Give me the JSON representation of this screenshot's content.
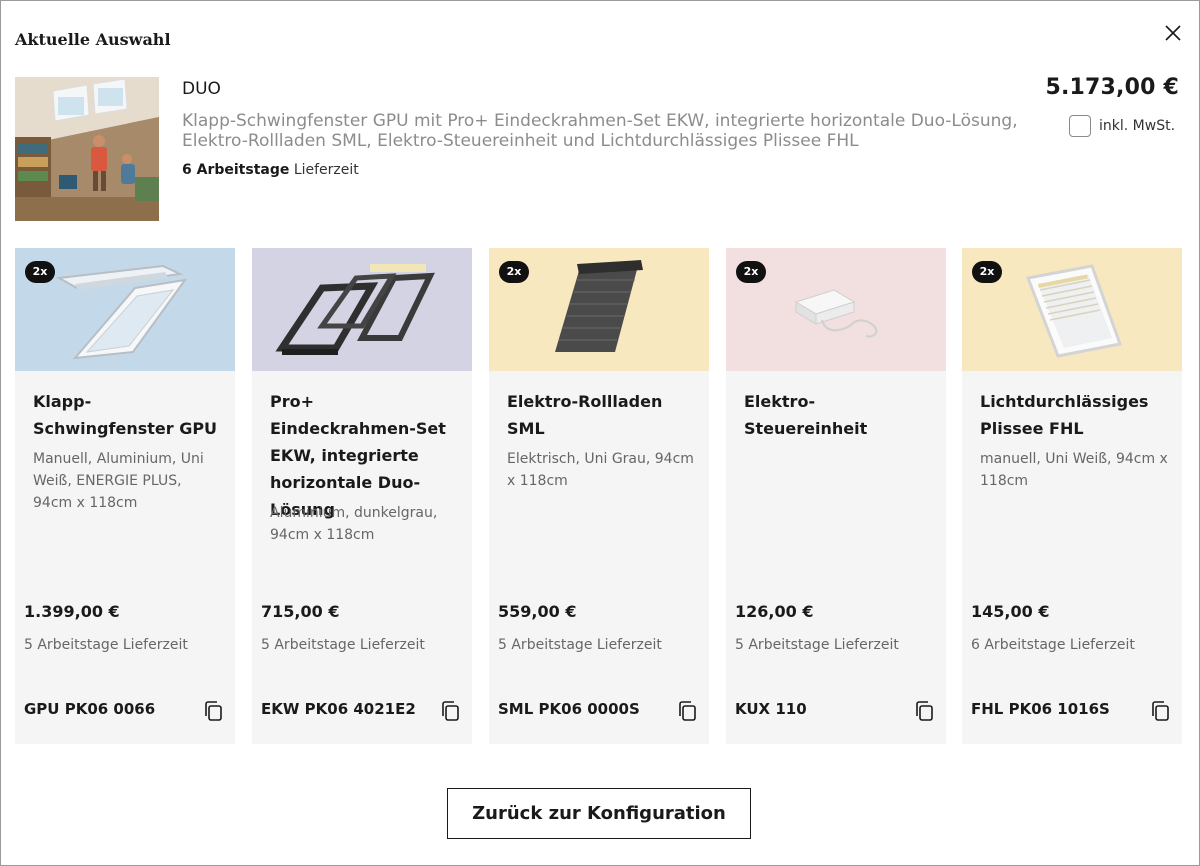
{
  "modal": {
    "title": "Aktuelle Auswahl"
  },
  "product": {
    "name": "DUO",
    "description": "Klapp-Schwingfenster GPU mit Pro+ Eindeckrahmen-Set EKW, integrierte horizontale Duo-Lösung, Elektro-Rollladen SML, Elektro-Steuereinheit und Lichtdurchlässiges Plissee FHL",
    "delivery_days": "6 Arbeitstage",
    "delivery_suffix": "Lieferzeit",
    "price": "5.173,00 €",
    "vat_label": "inkl. MwSt.",
    "vat_checked": false
  },
  "cards": [
    {
      "qty": "2x",
      "bg": "#c3d9ea",
      "icon": "roof-window-icon",
      "title": "Klapp-Schwingfenster GPU",
      "subtitle": "Manuell, Aluminium, Uni Weiß, ENERGIE PLUS, 94cm x 118cm",
      "price": "1.399,00 €",
      "delivery": "5 Arbeitstage Lieferzeit",
      "code": "GPU PK06 0066"
    },
    {
      "qty": "",
      "bg": "#d3d3e4",
      "icon": "flashing-frame-icon",
      "title": "Pro+ Eindeckrahmen-Set EKW, integrierte horizontale Duo-Lösung",
      "subtitle": "Aluminium, dunkelgrau, 94cm x 118cm",
      "price": "715,00 €",
      "delivery": "5 Arbeitstage Lieferzeit",
      "code": "EKW PK06 4021E2"
    },
    {
      "qty": "2x",
      "bg": "#f8e8bf",
      "icon": "roller-shutter-icon",
      "title": "Elektro-Rollladen SML",
      "subtitle": "Elektrisch, Uni Grau, 94cm x 118cm",
      "price": "559,00 €",
      "delivery": "5 Arbeitstage Lieferzeit",
      "code": "SML PK06 0000S"
    },
    {
      "qty": "2x",
      "bg": "#f2dfdf",
      "icon": "control-unit-icon",
      "title": "Elektro-Steuereinheit",
      "subtitle": "",
      "price": "126,00 €",
      "delivery": "5 Arbeitstage Lieferzeit",
      "code": "KUX 110"
    },
    {
      "qty": "2x",
      "bg": "#f8e8bf",
      "icon": "pleated-blind-icon",
      "title": "Lichtdurchlässiges Plissee FHL",
      "subtitle": "manuell, Uni Weiß, 94cm x 118cm",
      "price": "145,00 €",
      "delivery": "6 Arbeitstage Lieferzeit",
      "code": "FHL PK06 1016S"
    }
  ],
  "footer": {
    "back_label": "Zurück zur Konfiguration"
  }
}
